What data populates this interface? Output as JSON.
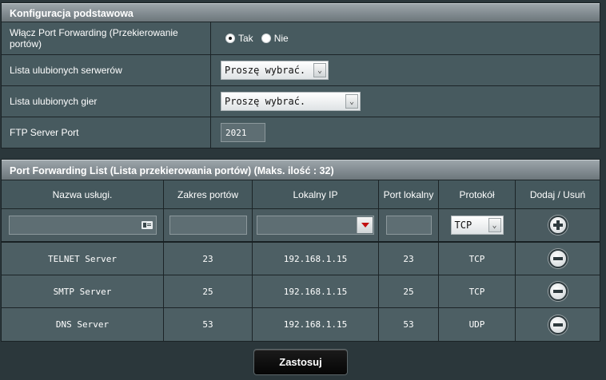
{
  "basic_config": {
    "header": "Konfiguracja podstawowa",
    "enable_pf_label": "Włącz Port Forwarding (Przekierowanie portów)",
    "radio_yes": "Tak",
    "radio_no": "Nie",
    "selected": "Tak",
    "fav_servers_label": "Lista ulubionych serwerów",
    "fav_servers_value": "Proszę wybrać.",
    "fav_games_label": "Lista ulubionych gier",
    "fav_games_value": "Proszę wybrać.",
    "ftp_label": "FTP Server Port",
    "ftp_value": "2021"
  },
  "pf_list": {
    "header": "Port Forwarding List (Lista przekierowania portów) (Maks. ilość : 32)",
    "columns": [
      "Nazwa usługi.",
      "Zakres portów",
      "Lokalny IP",
      "Port lokalny",
      "Protokół",
      "Dodaj / Usuń"
    ],
    "new_entry": {
      "protocol": "TCP"
    },
    "rows": [
      {
        "name": "TELNET Server",
        "range": "23",
        "ip": "192.168.1.15",
        "local_port": "23",
        "protocol": "TCP"
      },
      {
        "name": "SMTP Server",
        "range": "25",
        "ip": "192.168.1.15",
        "local_port": "25",
        "protocol": "TCP"
      },
      {
        "name": "DNS Server",
        "range": "53",
        "ip": "192.168.1.15",
        "local_port": "53",
        "protocol": "UDP"
      }
    ]
  },
  "apply_label": "Zastosuj",
  "icons": {
    "add": "plus-circle-icon",
    "remove": "minus-circle-icon",
    "card": "id-card-icon",
    "dropdown": "chevron-down-icon"
  },
  "colors": {
    "background": "#2b373b",
    "header_gradient_top": "#9ca5aa",
    "row_bg": "#475a5f",
    "button_bg": "#0a0a0a"
  }
}
